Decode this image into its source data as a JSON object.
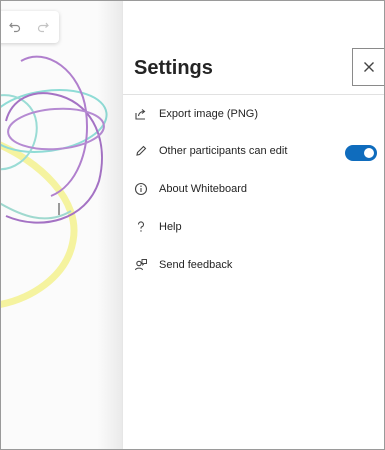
{
  "toolbar": {
    "undo_icon": "undo-icon",
    "redo_icon": "redo-icon"
  },
  "settings": {
    "title": "Settings",
    "close_icon": "close-icon",
    "items": [
      {
        "label": "Export image (PNG)",
        "icon": "export-image-icon"
      },
      {
        "label": "Other participants can edit",
        "icon": "pencil-icon",
        "toggle_on": true
      },
      {
        "label": "About Whiteboard",
        "icon": "info-icon"
      },
      {
        "label": "Help",
        "icon": "question-icon"
      },
      {
        "label": "Send feedback",
        "icon": "feedback-icon"
      }
    ]
  },
  "colors": {
    "accent": "#0f6cbd",
    "stroke_purple": "#a472c4",
    "stroke_teal": "#7fd3d0",
    "stroke_yellow": "#f4f29a"
  }
}
